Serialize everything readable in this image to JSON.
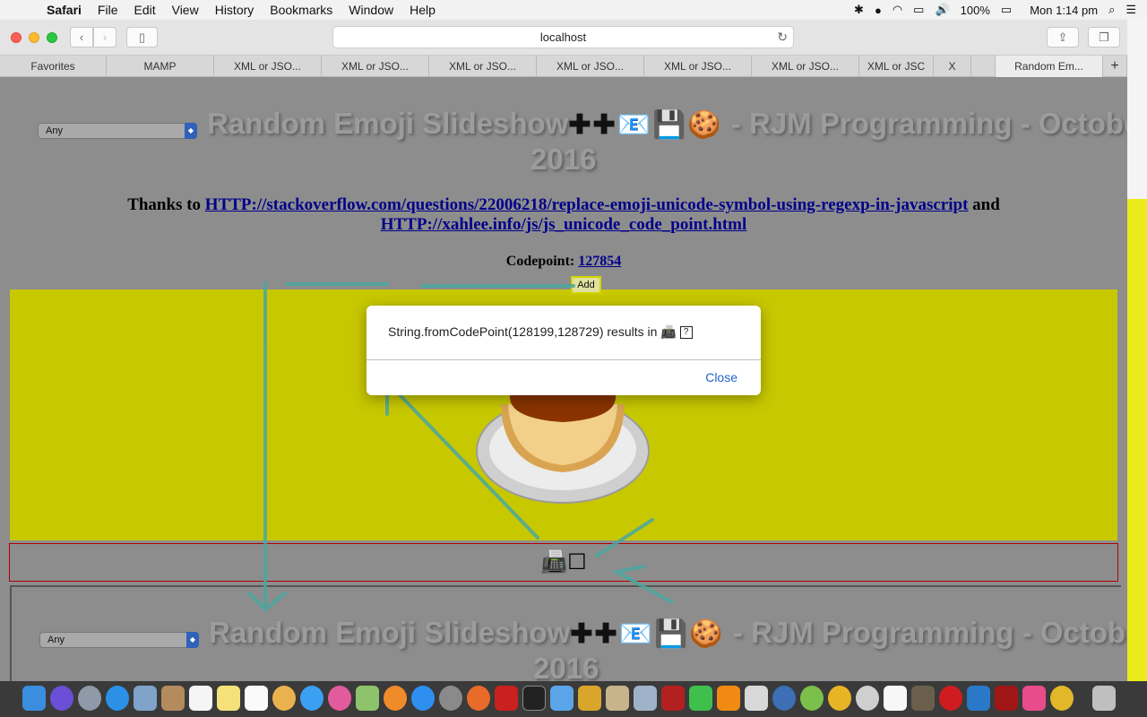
{
  "menubar": {
    "apple": "",
    "app_name": "Safari",
    "items": [
      "File",
      "Edit",
      "View",
      "History",
      "Bookmarks",
      "Window",
      "Help"
    ],
    "battery": "100%",
    "clock": "Mon 1:14 pm"
  },
  "browser": {
    "address": "localhost",
    "tabs": [
      "Favorites",
      "MAMP",
      "XML or JSO...",
      "XML or JSO...",
      "XML or JSO...",
      "XML or JSO...",
      "XML or JSO...",
      "XML or JSO...",
      "XML or JSC",
      "X",
      "",
      "Random Em..."
    ]
  },
  "page": {
    "select_value": "Any",
    "title_text": "Random Emoji Slideshow",
    "title_emojis": "✚✚📧💾🍪",
    "title_suffix": " - RJM Programming - October,",
    "title_year": "2016",
    "thanks_prefix": "Thanks to ",
    "link1": "HTTP://stackoverflow.com/questions/22006218/replace-emoji-unicode-symbol-using-regexp-in-javascript",
    "thanks_and": " and",
    "link2": "HTTP://xahlee.info/js/js_unicode_code_point.html",
    "codepoint_label": "Codepoint: ",
    "codepoint_value": "127854",
    "add_label": "Add",
    "emoji_row": "📠☐"
  },
  "dialog": {
    "message": "String.fromCodePoint(128199,128729) results in 📠",
    "unknown_glyph": "?",
    "close_label": "Close"
  },
  "colors": {
    "dim_background": "#8d8d8d",
    "yellow_area": "#c8c800",
    "link": "#00008b",
    "close_button": "#1f64c8",
    "annotation": "#4aa8a0"
  }
}
